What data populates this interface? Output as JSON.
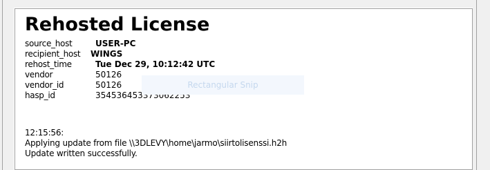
{
  "license": {
    "title": "Rehosted License",
    "fields": [
      {
        "key": "source_host",
        "value": "USER-PC"
      },
      {
        "key": "recipient_host",
        "value": "WINGS"
      },
      {
        "key": "rehost_time",
        "value": "Tue Dec 29, 10:12:42 UTC"
      },
      {
        "key": "vendor",
        "value": "50126"
      },
      {
        "key": "vendor_id",
        "value": "50126"
      },
      {
        "key": "hasp_id",
        "value": "354536453373062253"
      }
    ]
  },
  "overlay": {
    "label": "Rectangular Snip"
  },
  "log": {
    "timestamp": "12:15:56:",
    "line1": "Applying update from file \\\\3DLEVY\\home\\jarmo\\siirtolisenssi.h2h",
    "line2": "Update written successfully."
  }
}
